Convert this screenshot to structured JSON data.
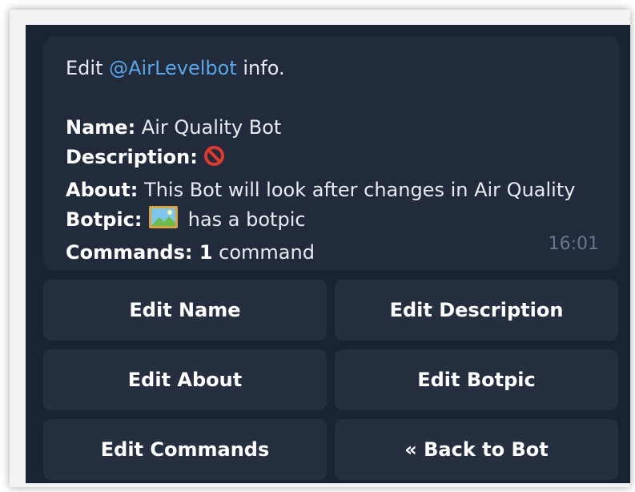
{
  "message": {
    "intro_prefix": "Edit ",
    "mention": "@AirLevelbot",
    "intro_suffix": " info.",
    "name_label": "Name:",
    "name_value": " Air Quality Bot",
    "description_label": "Description:",
    "description_icon": "prohibited-icon",
    "about_label": "About:",
    "about_value": " This Bot will look after changes in Air Quality",
    "botpic_label": "Botpic:",
    "botpic_icon": "framed-picture-icon",
    "botpic_value": " has a botpic",
    "commands_label": "Commands:",
    "commands_count": " 1",
    "commands_value": " command",
    "time": "16:01"
  },
  "keyboard": {
    "edit_name": "Edit Name",
    "edit_description": "Edit Description",
    "edit_about": "Edit About",
    "edit_botpic": "Edit Botpic",
    "edit_commands": "Edit Commands",
    "back_to_bot": "« Back to Bot"
  },
  "colors": {
    "chat_background": "#1a2332",
    "bubble_background": "#212b3b",
    "button_background": "#262f40",
    "mention_color": "#5aa6e8",
    "prohibited_red": "#e03a2f"
  }
}
